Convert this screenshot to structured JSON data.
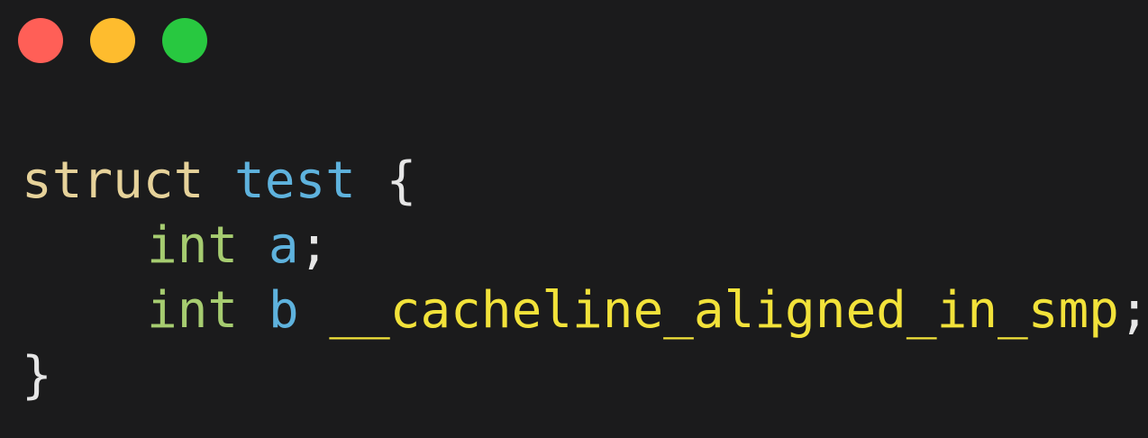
{
  "window": {
    "traffic_lights": [
      {
        "name": "close",
        "color": "#ff5f57"
      },
      {
        "name": "minimize",
        "color": "#febc2e"
      },
      {
        "name": "zoom",
        "color": "#28c840"
      }
    ]
  },
  "code": {
    "colors": {
      "keyword": "#e6d29a",
      "identifier": "#5eb2dd",
      "type": "#a6cc70",
      "macro": "#f2e23a",
      "punct": "#e6e6e6"
    },
    "lines": [
      {
        "tokens": [
          {
            "text": "struct",
            "kind": "keyword"
          },
          {
            "text": " ",
            "kind": "punct"
          },
          {
            "text": "test",
            "kind": "identifier"
          },
          {
            "text": " {",
            "kind": "punct"
          }
        ]
      },
      {
        "indent": true,
        "tokens": [
          {
            "text": "int",
            "kind": "type"
          },
          {
            "text": " ",
            "kind": "punct"
          },
          {
            "text": "a",
            "kind": "identifier"
          },
          {
            "text": ";",
            "kind": "punct"
          }
        ]
      },
      {
        "indent": true,
        "tokens": [
          {
            "text": "int",
            "kind": "type"
          },
          {
            "text": " ",
            "kind": "punct"
          },
          {
            "text": "b",
            "kind": "identifier"
          },
          {
            "text": " ",
            "kind": "punct"
          },
          {
            "text": "__cacheline_aligned_in_smp",
            "kind": "macro"
          },
          {
            "text": ";",
            "kind": "punct"
          }
        ]
      },
      {
        "tokens": [
          {
            "text": "}",
            "kind": "punct"
          }
        ]
      }
    ]
  }
}
